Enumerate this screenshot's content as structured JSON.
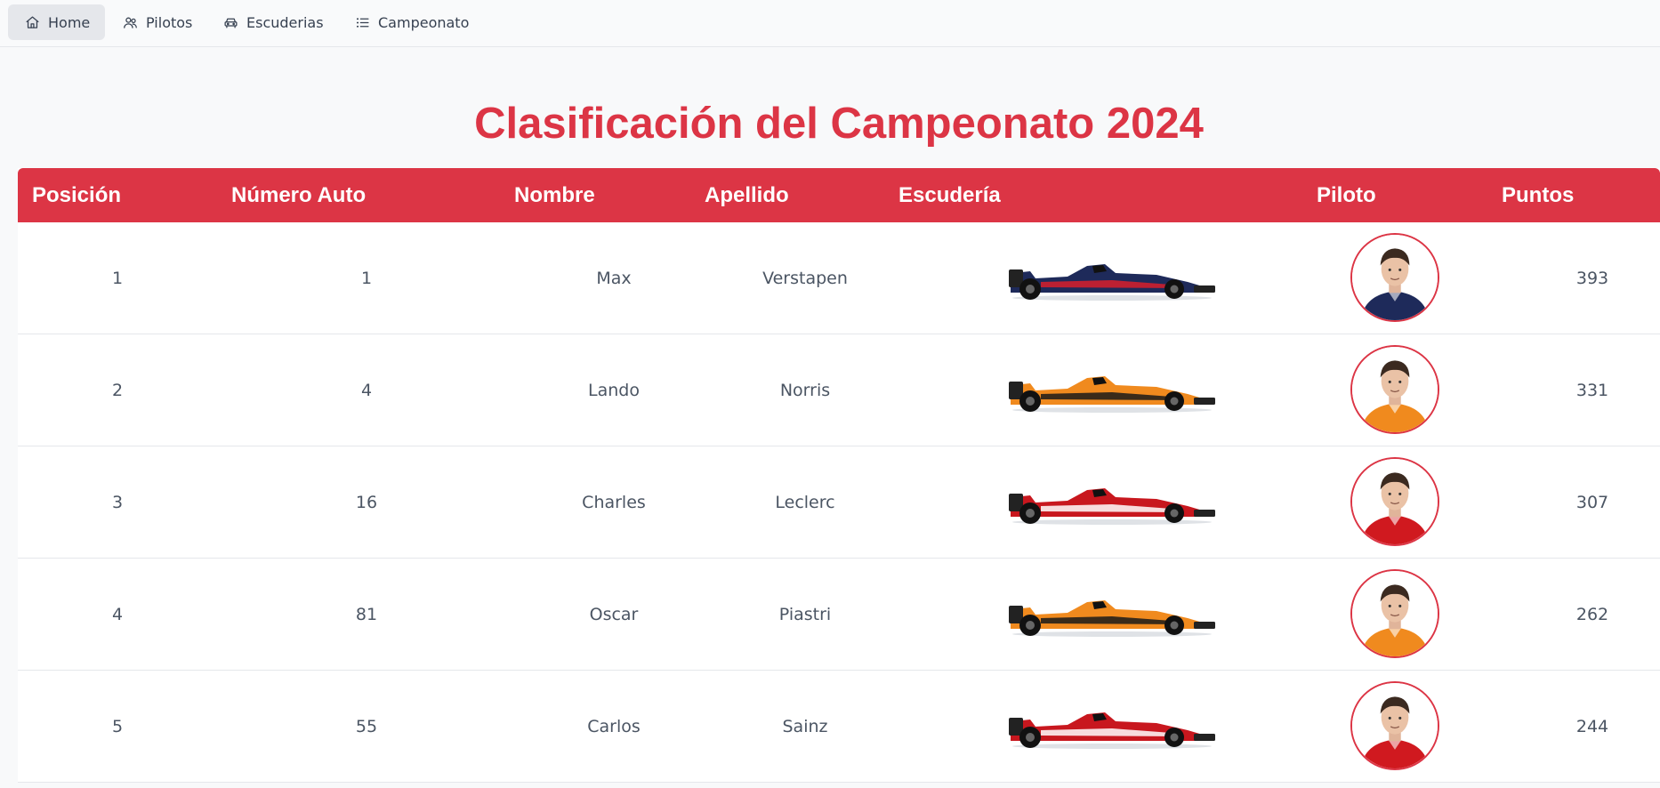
{
  "nav": {
    "items": [
      {
        "label": "Home",
        "icon": "home-icon",
        "active": true
      },
      {
        "label": "Pilotos",
        "icon": "users-icon",
        "active": false
      },
      {
        "label": "Escuderias",
        "icon": "car-icon",
        "active": false
      },
      {
        "label": "Campeonato",
        "icon": "list-icon",
        "active": false
      }
    ]
  },
  "page": {
    "title": "Clasificación del Campeonato 2024"
  },
  "table": {
    "headers": {
      "position": "Posición",
      "car_number": "Número Auto",
      "first_name": "Nombre",
      "last_name": "Apellido",
      "team": "Escudería",
      "driver": "Piloto",
      "points": "Puntos"
    },
    "rows": [
      {
        "position": "1",
        "car_number": "1",
        "first_name": "Max",
        "last_name": "Verstapen",
        "points": "393",
        "team_livery": "red-bull",
        "body_color": "#1e2a5a",
        "accent_color": "#d81e2c",
        "suit_color": "#1e2a5a"
      },
      {
        "position": "2",
        "car_number": "4",
        "first_name": "Lando",
        "last_name": "Norris",
        "points": "331",
        "team_livery": "mclaren",
        "body_color": "#f08a1e",
        "accent_color": "#1a1a1a",
        "suit_color": "#f08a1e"
      },
      {
        "position": "3",
        "car_number": "16",
        "first_name": "Charles",
        "last_name": "Leclerc",
        "points": "307",
        "team_livery": "ferrari",
        "body_color": "#c8171e",
        "accent_color": "#ffffff",
        "suit_color": "#d0191f"
      },
      {
        "position": "4",
        "car_number": "81",
        "first_name": "Oscar",
        "last_name": "Piastri",
        "points": "262",
        "team_livery": "mclaren",
        "body_color": "#f08a1e",
        "accent_color": "#1a1a1a",
        "suit_color": "#f08a1e"
      },
      {
        "position": "5",
        "car_number": "55",
        "first_name": "Carlos",
        "last_name": "Sainz",
        "points": "244",
        "team_livery": "ferrari",
        "body_color": "#c8171e",
        "accent_color": "#ffffff",
        "suit_color": "#d0191f"
      }
    ]
  },
  "colors": {
    "accent": "#dc3545",
    "text": "#4b5563",
    "nav_active_bg": "#e5e7eb"
  }
}
